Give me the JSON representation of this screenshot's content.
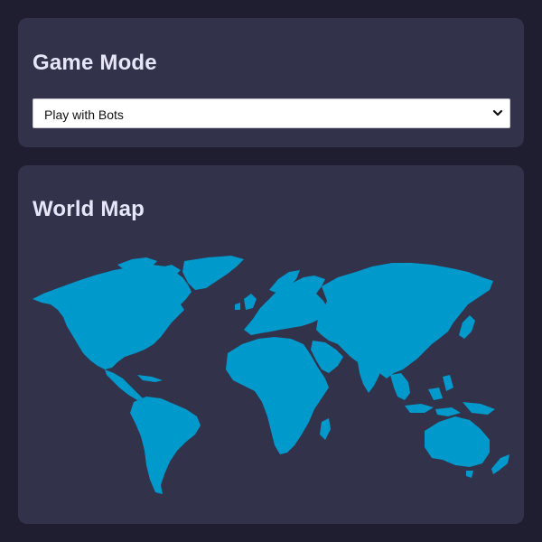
{
  "game_mode": {
    "title": "Game Mode",
    "selected_option": "Play with Bots",
    "chevron_icon": "chevron-down-icon"
  },
  "world_map": {
    "title": "World Map",
    "land_color": "#0099cc",
    "map_icon": "world-map-icon"
  },
  "colors": {
    "background": "#1e1e30",
    "card": "#32324a",
    "title": "#e6e6f8",
    "accent": "#0099cc"
  }
}
